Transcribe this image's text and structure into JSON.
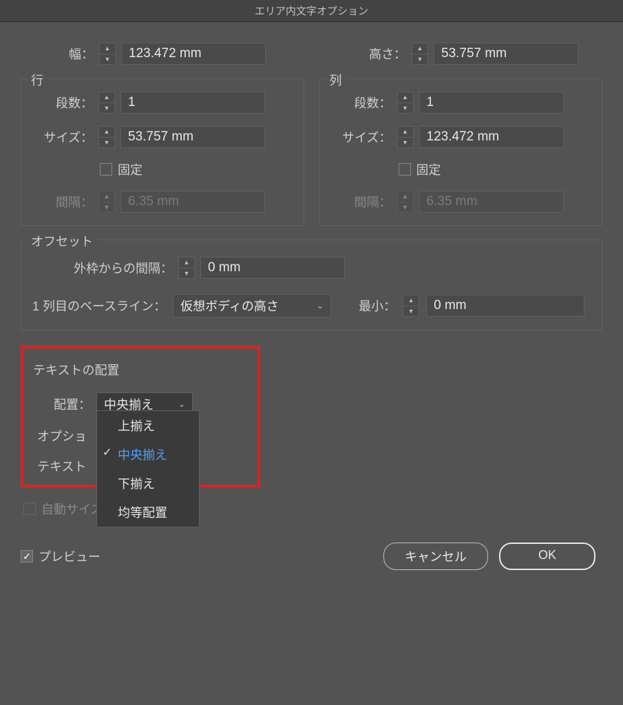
{
  "dialog": {
    "title": "エリア内文字オプション"
  },
  "width": {
    "label": "幅：",
    "value": "123.472 mm"
  },
  "height": {
    "label": "高さ：",
    "value": "53.757 mm"
  },
  "rows": {
    "title": "行",
    "count": {
      "label": "段数：",
      "value": "1"
    },
    "size": {
      "label": "サイズ：",
      "value": "53.757 mm"
    },
    "fixed": {
      "label": "固定"
    },
    "gutter": {
      "label": "間隔：",
      "value": "6.35 mm"
    }
  },
  "cols": {
    "title": "列",
    "count": {
      "label": "段数：",
      "value": "1"
    },
    "size": {
      "label": "サイズ：",
      "value": "123.472 mm"
    },
    "fixed": {
      "label": "固定"
    },
    "gutter": {
      "label": "間隔：",
      "value": "6.35 mm"
    }
  },
  "offset": {
    "title": "オフセット",
    "inset": {
      "label": "外枠からの間隔：",
      "value": "0 mm"
    },
    "baseline": {
      "label": "1 列目のベースライン：",
      "value": "仮想ボディの高さ"
    },
    "min": {
      "label": "最小：",
      "value": "0 mm"
    }
  },
  "textAlign": {
    "title": "テキストの配置",
    "label": "配置：",
    "value": "中央揃え",
    "options": [
      "上揃え",
      "中央揃え",
      "下揃え",
      "均等配置"
    ]
  },
  "optionsLabel": "オプショ",
  "textLabel": "テキスト",
  "autosize": {
    "label": "自動サイズ調整"
  },
  "preview": {
    "label": "プレビュー"
  },
  "buttons": {
    "cancel": "キャンセル",
    "ok": "OK"
  }
}
